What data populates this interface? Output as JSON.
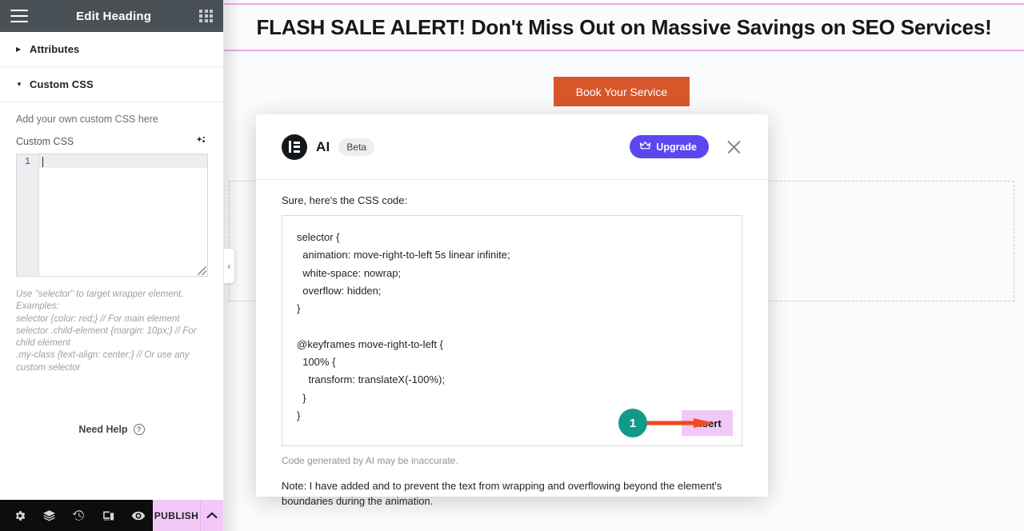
{
  "panel": {
    "header": {
      "title": "Edit Heading",
      "menu_icon": "hamburger-icon",
      "apps_icon": "apps-grid-icon"
    },
    "sections": [
      {
        "label": "Attributes",
        "expanded": false,
        "caret": "▶"
      },
      {
        "label": "Custom CSS",
        "expanded": true,
        "caret": "▼"
      }
    ],
    "custom_css": {
      "hint": "Add your own custom CSS here",
      "field_label": "Custom CSS",
      "ai_icon": "ai-sparkle-icon",
      "line_number": "1",
      "value": "",
      "examples": [
        "Use \"selector\" to target wrapper element.",
        "Examples:",
        "selector {color: red;} // For main element",
        "selector .child-element {margin: 10px;} // For child element",
        ".my-class {text-align: center;} // Or use any custom selector"
      ]
    },
    "need_help": {
      "label": "Need Help",
      "icon": "question-mark-icon"
    },
    "footer": {
      "icons": [
        {
          "name": "settings-gear-icon"
        },
        {
          "name": "layers-navigator-icon"
        },
        {
          "name": "history-revisions-icon"
        },
        {
          "name": "responsive-device-icon"
        },
        {
          "name": "preview-eye-icon"
        }
      ],
      "publish_label": "PUBLISH",
      "publish_caret_icon": "chevron-up-icon"
    }
  },
  "canvas": {
    "heading": "FLASH SALE ALERT! Don't Miss Out on Massive Savings on SEO Services!",
    "cta_button": "Book Your Service",
    "collapse_handle_icon": "chevron-left-icon",
    "accent_border_color": "#e9a8f0",
    "cta_color": "#d9562b"
  },
  "modal": {
    "brand_name": "AI",
    "brand_logo_icon": "elementor-logo-icon",
    "badge": "Beta",
    "upgrade_label": "Upgrade",
    "upgrade_icon": "crown-icon",
    "upgrade_color": "#5b46f0",
    "close_icon": "close-x-icon",
    "lead_text": "Sure, here's the CSS code:",
    "code": "selector {\n  animation: move-right-to-left 5s linear infinite;\n  white-space: nowrap;\n  overflow: hidden;\n}\n\n@keyframes move-right-to-left {\n  100% {\n    transform: translateX(-100%);\n  }\n}",
    "insert_label": "Insert",
    "insert_color": "#f2c8f7",
    "disclaimer": "Code generated by AI may be inaccurate.",
    "note": "Note: I have added and to prevent the text from wrapping and overflowing beyond the element's boundaries during the animation."
  },
  "annotation": {
    "step_number": "1",
    "circle_color": "#13998a",
    "arrow_color": "#ef4a1e",
    "arrow_icon": "right-arrow-annotation"
  }
}
